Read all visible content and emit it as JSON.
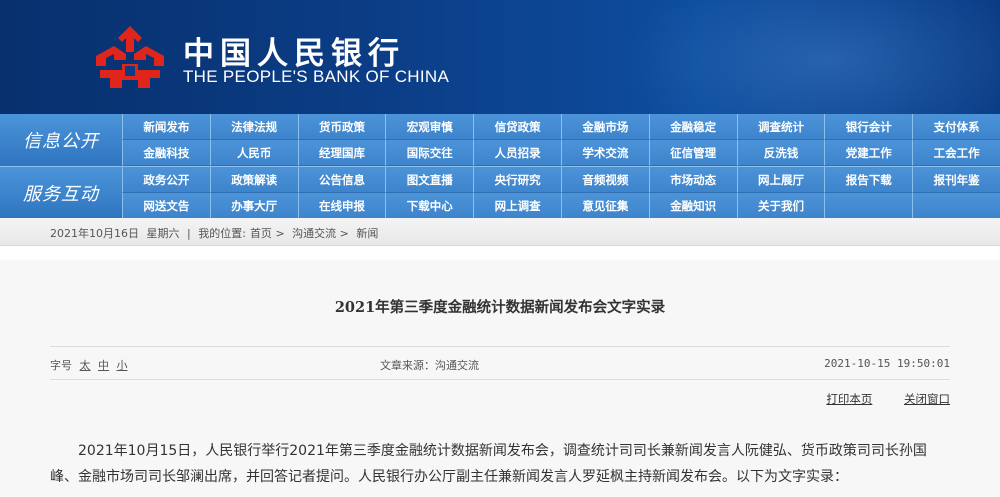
{
  "header": {
    "title_cn": "中国人民银行",
    "title_en": "THE PEOPLE'S BANK OF CHINA",
    "logo_color": "#e0251b",
    "background": "#0b3c84"
  },
  "nav": {
    "section1_label": "信息公开",
    "section1_rows": [
      [
        "新闻发布",
        "法律法规",
        "货币政策",
        "宏观审慎",
        "信贷政策",
        "金融市场",
        "金融稳定",
        "调查统计",
        "银行会计",
        "支付体系"
      ],
      [
        "金融科技",
        "人民币",
        "经理国库",
        "国际交往",
        "人员招录",
        "学术交流",
        "征信管理",
        "反洗钱",
        "党建工作",
        "工会工作"
      ]
    ],
    "section2_label": "服务互动",
    "section2_rows": [
      [
        "政务公开",
        "政策解读",
        "公告信息",
        "图文直播",
        "央行研究",
        "音频视频",
        "市场动态",
        "网上展厅",
        "报告下载",
        "报刊年鉴"
      ],
      [
        "网送文告",
        "办事大厅",
        "在线申报",
        "下载中心",
        "网上调查",
        "意见征集",
        "金融知识",
        "关于我们",
        "",
        ""
      ]
    ]
  },
  "breadcrumb": {
    "date": "2021年10月16日",
    "weekday": "星期六",
    "location_prefix": "我的位置:",
    "home": "首页",
    "sep": ">",
    "level1": "沟通交流",
    "level2": "新闻"
  },
  "article": {
    "title": "2021年第三季度金融统计数据新闻发布会文字实录",
    "fontsize_label": "字号",
    "size_large": "太",
    "size_medium": "中",
    "size_small": "小",
    "source": "文章来源：沟通交流",
    "date": "2021-10-15 19:50:01",
    "print_label": "打印本页",
    "close_label": "关闭窗口",
    "paragraph": "2021年10月15日，人民银行举行2021年第三季度金融统计数据新闻发布会，调查统计司司长兼新闻发言人阮健弘、货币政策司司长孙国峰、金融市场司司长邹澜出席，并回答记者提问。人民银行办公厅副主任兼新闻发言人罗延枫主持新闻发布会。以下为文字实录："
  }
}
